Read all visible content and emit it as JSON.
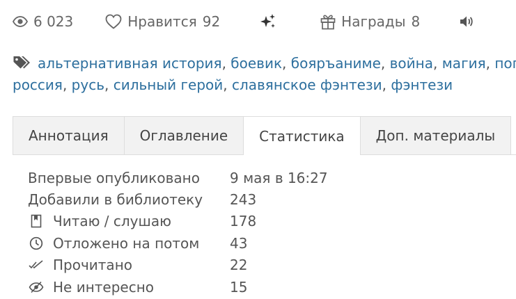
{
  "stats_bar": {
    "views": "6 023",
    "likes_label": "Нравится",
    "likes_count": "92",
    "awards_label": "Награды",
    "awards_count": "8",
    "icons": [
      "eye-icon",
      "heart-icon",
      "sparkle-icon",
      "gift-icon",
      "speaker-icon"
    ]
  },
  "tags": [
    "альтернативная история",
    "боевик",
    "бояръаниме",
    "война",
    "магия",
    "попаданец",
    "россия",
    "русь",
    "сильный герой",
    "славянское фэнтези",
    "фэнтези"
  ],
  "tabs": [
    {
      "label": "Аннотация",
      "active": false
    },
    {
      "label": "Оглавление",
      "active": false
    },
    {
      "label": "Статистика",
      "active": true
    },
    {
      "label": "Доп. материалы",
      "active": false
    }
  ],
  "statistics": {
    "first_published": {
      "label": "Впервые опубликовано",
      "value": "9 мая в 16:27"
    },
    "added_to_library": {
      "label": "Добавили в библиотеку",
      "value": "243"
    },
    "reading": {
      "label": "Читаю / слушаю",
      "value": "178",
      "icon": "bookmark-icon"
    },
    "postponed": {
      "label": "Отложено на потом",
      "value": "43",
      "icon": "clock-icon"
    },
    "finished": {
      "label": "Прочитано",
      "value": "22",
      "icon": "double-check-icon"
    },
    "not_interested": {
      "label": "Не интересно",
      "value": "15",
      "icon": "eye-slash-icon"
    }
  },
  "colors": {
    "link": "#2d6f9e",
    "text": "#555555",
    "tab_bg": "#f2f2f2",
    "border": "#dddddd"
  }
}
